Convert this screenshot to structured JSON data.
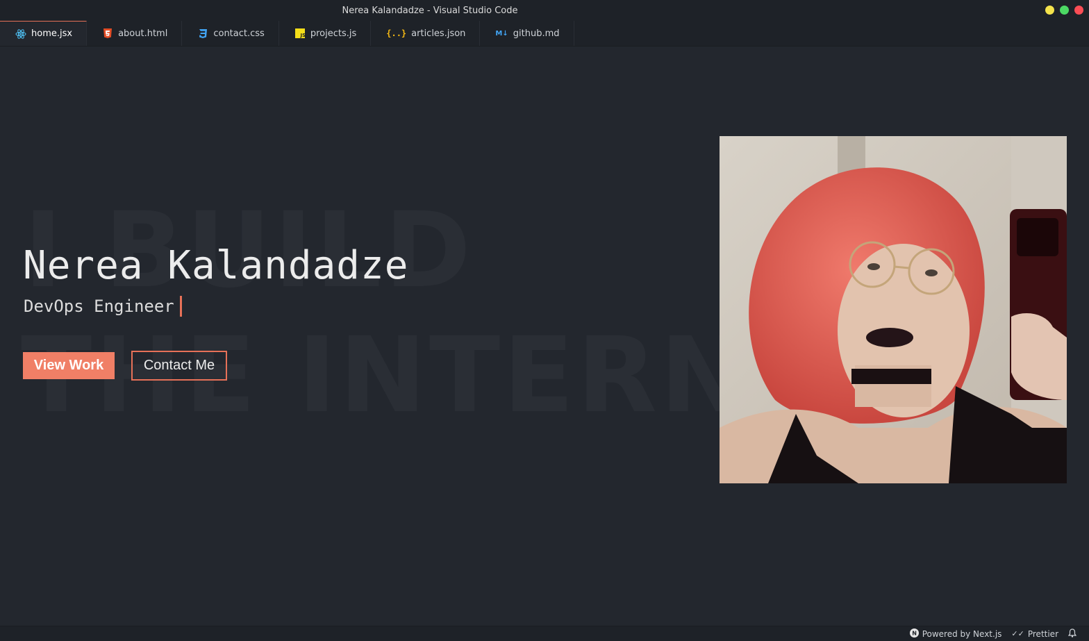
{
  "window": {
    "title": "Nerea Kalandadze - Visual Studio Code",
    "controls": [
      {
        "name": "minimize",
        "color": "#f4e34c"
      },
      {
        "name": "maximize",
        "color": "#4cd964"
      },
      {
        "name": "close",
        "color": "#fc4d55"
      }
    ]
  },
  "tabs": [
    {
      "label": "home.jsx",
      "icon": "react-icon",
      "icon_color": "#4fc3f7",
      "active": true
    },
    {
      "label": "about.html",
      "icon": "html5-icon",
      "icon_color": "#e44d26",
      "active": false
    },
    {
      "label": "contact.css",
      "icon": "css3-icon",
      "icon_color": "#42a5f5",
      "active": false
    },
    {
      "label": "projects.js",
      "icon": "javascript-icon",
      "icon_color": "#f5de19",
      "active": false
    },
    {
      "label": "articles.json",
      "icon": "json-icon",
      "icon_color": "#f5b914",
      "active": false
    },
    {
      "label": "github.md",
      "icon": "markdown-icon",
      "icon_color": "#42a5f5",
      "active": false
    }
  ],
  "hero": {
    "background_text_line1": "I BUILD",
    "background_text_line2": "THE INTERNET",
    "name": "Nerea Kalandadze",
    "role": "DevOps Engineer",
    "primary_button": "View Work",
    "secondary_button": "Contact Me",
    "accent_color": "#f07f66"
  },
  "statusbar": {
    "powered_by": "Powered by Next.js",
    "formatter": "Prettier"
  }
}
